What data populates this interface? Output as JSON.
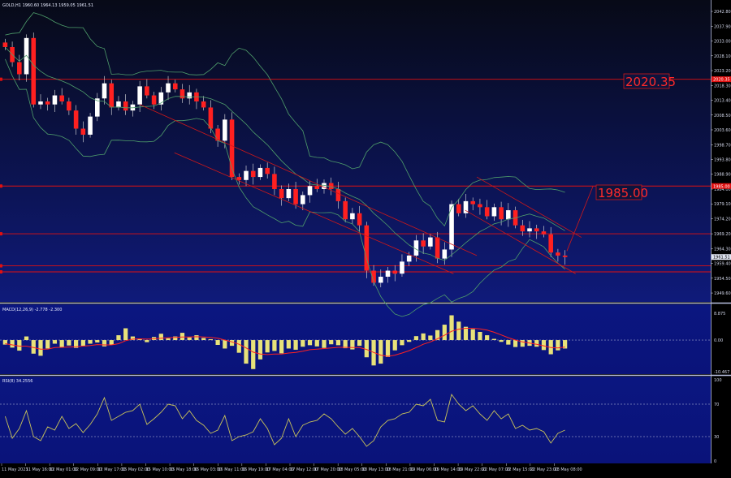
{
  "header": {
    "symbol_line": "GOLD,H1  1960.60  1964.13  1959.05  1961.51"
  },
  "colors": {
    "background_top": "#070a17",
    "background_bottom": "#0f1a7a",
    "bull_candle": "#ffffff",
    "bear_candle": "#ff2020",
    "wick": "#e6e6e6",
    "bollinger": "#4f9e6b",
    "channel": "#d01818",
    "level_line": "#e01010",
    "macd_bar": "#e8e27a",
    "macd_signal": "#ff2020",
    "rsi_line": "#c9c35a",
    "axis_text": "#cfd3e6",
    "panel_separator": "#b8bfe0"
  },
  "annotations": {
    "level_2020": "2020.35",
    "level_1985": "1985.00"
  },
  "chart_data": [
    {
      "type": "candlestick",
      "title": "GOLD,H1",
      "ylim": [
        1947.2,
        2045.5
      ],
      "y_ticks": [
        "2042.80",
        "2037.90",
        "2033.00",
        "2028.10",
        "2023.20",
        "2018.30",
        "2013.40",
        "2008.50",
        "2003.60",
        "1998.70",
        "1993.80",
        "1988.90",
        "1984.00",
        "1979.10",
        "1974.20",
        "1969.20",
        "1964.30",
        "1959.40",
        "1954.50",
        "1949.60"
      ],
      "price_tags": [
        "2020.35",
        "1985.00",
        "1961.51"
      ],
      "x_ticks": [
        "11 May 2023",
        "11 May 16:00",
        "12 May 01:00",
        "12 May 09:00",
        "12 May 17:00",
        "15 May 02:00",
        "15 May 10:00",
        "15 May 18:00",
        "16 May 03:00",
        "16 May 11:00",
        "16 May 19:00",
        "17 May 04:00",
        "17 May 12:00",
        "17 May 20:00",
        "18 May 05:00",
        "18 May 13:00",
        "18 May 21:00",
        "19 May 06:00",
        "19 May 14:00",
        "19 May 22:00",
        "22 May 07:00",
        "22 May 15:00",
        "22 May 23:00",
        "23 May 08:00"
      ],
      "horizontal_levels": [
        2020.35,
        1985.0,
        1969.2,
        1958.6,
        1956.6
      ],
      "channel_lines": [
        {
          "x1": 0.24,
          "y1": 2012.0,
          "x2": 0.82,
          "y2": 1962.0
        },
        {
          "x1": 0.3,
          "y1": 1996.0,
          "x2": 0.78,
          "y2": 1956.0
        },
        {
          "x1": 0.82,
          "y1": 1988.0,
          "x2": 1.0,
          "y2": 1968.0
        },
        {
          "x1": 0.8,
          "y1": 1977.0,
          "x2": 0.99,
          "y2": 1956.0
        }
      ],
      "projection": {
        "x1": 0.975,
        "y1": 1963.5,
        "x2": 1.02,
        "y2": 1985.0
      },
      "series": [
        {
          "name": "price",
          "close_path": [
            2031,
            2026,
            2022,
            2034,
            2012,
            2013,
            2012,
            2015,
            2013,
            2010,
            2004,
            2002,
            2008,
            2014,
            2019,
            2011,
            2013,
            2010,
            2012,
            2018,
            2015,
            2012,
            2016,
            2019,
            2017,
            2014,
            2016,
            2013,
            2011,
            2004,
            2000,
            2007,
            1988,
            1987,
            1990,
            1988,
            1991,
            1989,
            1984,
            1981,
            1984,
            1979,
            1982,
            1985,
            1984,
            1986,
            1984,
            1980,
            1974,
            1976,
            1972,
            1957,
            1953,
            1955,
            1957,
            1956,
            1960,
            1962,
            1967,
            1965,
            1968,
            1961,
            1964,
            1979,
            1976,
            1980,
            1979,
            1978,
            1975,
            1978,
            1974,
            1977,
            1972,
            1970,
            1971,
            1970,
            1969,
            1963,
            1962,
            1961.5
          ]
        }
      ],
      "bollinger": true
    },
    {
      "type": "histogram",
      "title": "MACD(12,26,9) -2.778 -2.300",
      "ylim": [
        -10.467,
        8.875
      ],
      "y_ticks": [
        "8.875",
        "0.00",
        "-10.467"
      ],
      "series": [
        {
          "name": "MACD",
          "values": [
            -1.5,
            -2.5,
            -3.5,
            1.2,
            -4.5,
            -5.2,
            -2.8,
            -1.2,
            -2.4,
            -1.8,
            -2.6,
            -1.9,
            -1.2,
            -0.8,
            -2.1,
            -1.6,
            1.6,
            3.9,
            1.2,
            0.4,
            -0.7,
            1.0,
            2.1,
            0.6,
            1.2,
            2.4,
            0.9,
            1.6,
            0.7,
            0.3,
            -1.6,
            -2.8,
            -1.9,
            -4.2,
            -7.8,
            -9.6,
            -6.4,
            -4.1,
            -3.6,
            -4.4,
            -2.8,
            -3.2,
            -2.2,
            -1.7,
            -2.1,
            -2.6,
            -1.4,
            -1.7,
            -2.7,
            -3.1,
            -1.9,
            -5.7,
            -8.4,
            -7.8,
            -5.6,
            -3.4,
            -1.7,
            -0.6,
            1.3,
            2.2,
            1.5,
            3.3,
            5.1,
            8.2,
            6.1,
            4.4,
            3.6,
            2.7,
            1.6,
            0.4,
            -0.6,
            -1.5,
            -2.3,
            -2.2,
            -1.9,
            -2.2,
            -3.3,
            -4.7,
            -3.4,
            -2.8
          ]
        },
        {
          "name": "Signal",
          "values": [
            -1.2,
            -1.6,
            -2.0,
            -2.0,
            -2.5,
            -3.0,
            -3.0,
            -2.5,
            -2.4,
            -2.3,
            -2.2,
            -2.0,
            -1.8,
            -1.5,
            -1.6,
            -1.6,
            -1.2,
            -0.2,
            0.3,
            0.4,
            0.3,
            0.4,
            0.6,
            0.8,
            0.9,
            1.0,
            1.0,
            1.1,
            1.0,
            0.9,
            0.6,
            0.0,
            -0.6,
            -1.4,
            -2.6,
            -4.0,
            -4.6,
            -4.8,
            -4.6,
            -4.6,
            -4.3,
            -4.1,
            -3.7,
            -3.2,
            -3.0,
            -2.8,
            -2.6,
            -2.4,
            -2.4,
            -2.5,
            -2.5,
            -3.1,
            -4.1,
            -5.0,
            -5.4,
            -5.0,
            -4.3,
            -3.5,
            -2.5,
            -1.4,
            -0.6,
            0.4,
            1.6,
            2.9,
            3.6,
            3.9,
            3.9,
            3.7,
            3.3,
            2.6,
            1.7,
            0.8,
            0.0,
            -0.6,
            -1.0,
            -1.4,
            -1.9,
            -2.5,
            -2.6,
            -2.3
          ]
        }
      ]
    },
    {
      "type": "line",
      "title": "RSI(8) 34.2556",
      "ylim": [
        0,
        100
      ],
      "y_ticks": [
        "100",
        "70",
        "30",
        "0"
      ],
      "levels": [
        70,
        30
      ],
      "series": [
        {
          "name": "RSI",
          "values": [
            55,
            28,
            40,
            62,
            30,
            25,
            42,
            38,
            55,
            40,
            46,
            35,
            45,
            58,
            78,
            50,
            55,
            60,
            62,
            70,
            45,
            52,
            60,
            70,
            68,
            52,
            62,
            50,
            44,
            34,
            38,
            56,
            25,
            30,
            32,
            36,
            52,
            40,
            20,
            28,
            52,
            30,
            44,
            48,
            50,
            58,
            52,
            42,
            33,
            40,
            30,
            18,
            25,
            42,
            50,
            52,
            58,
            60,
            70,
            68,
            76,
            50,
            48,
            82,
            70,
            62,
            68,
            58,
            50,
            62,
            52,
            58,
            40,
            44,
            38,
            40,
            36,
            22,
            34,
            38
          ]
        }
      ]
    }
  ]
}
